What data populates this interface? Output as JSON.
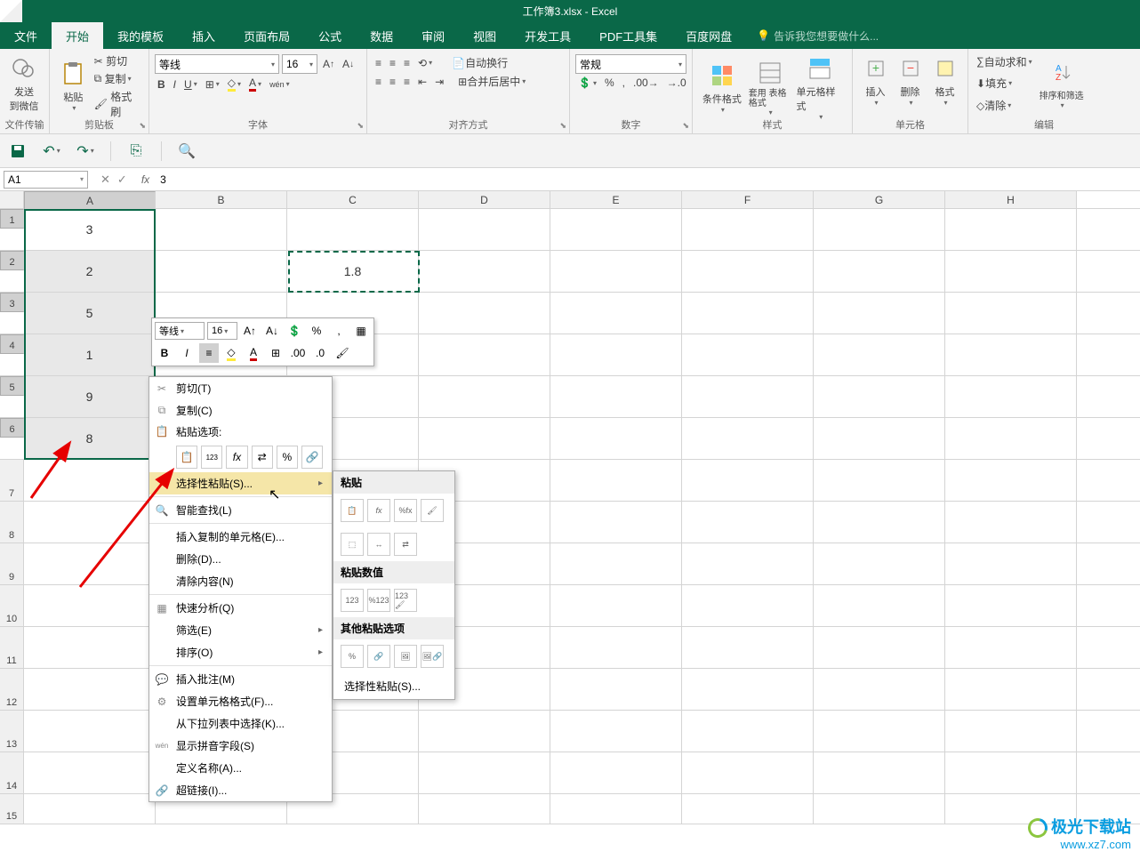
{
  "titlebar": {
    "title": "工作簿3.xlsx - Excel"
  },
  "menu": {
    "items": [
      "文件",
      "开始",
      "我的模板",
      "插入",
      "页面布局",
      "公式",
      "数据",
      "审阅",
      "视图",
      "开发工具",
      "PDF工具集",
      "百度网盘"
    ],
    "active": 1,
    "tellme": "告诉我您想要做什么..."
  },
  "ribbon": {
    "send": {
      "l1": "发送",
      "l2": "到微信",
      "group": "文件传输"
    },
    "clipboard": {
      "paste": "粘贴",
      "cut": "剪切",
      "copy": "复制",
      "format": "格式刷",
      "group": "剪贴板"
    },
    "font": {
      "name": "等线",
      "size": "16",
      "group": "字体"
    },
    "align": {
      "wrap": "自动换行",
      "merge": "合并后居中",
      "group": "对齐方式"
    },
    "number": {
      "format": "常规",
      "group": "数字"
    },
    "styles": {
      "cond": "条件格式",
      "table": "套用\n表格格式",
      "cell": "单元格样式",
      "group": "样式"
    },
    "cells": {
      "insert": "插入",
      "delete": "删除",
      "format": "格式",
      "group": "单元格"
    },
    "editing": {
      "sum": "自动求和",
      "fill": "填充",
      "clear": "清除",
      "sort": "排序和筛选",
      "group": "编辑"
    }
  },
  "namebox": "A1",
  "formula": "3",
  "columns": [
    "A",
    "B",
    "C",
    "D",
    "E",
    "F",
    "G",
    "H"
  ],
  "rows": [
    "1",
    "2",
    "3",
    "4",
    "5",
    "6",
    "7",
    "8",
    "9",
    "10",
    "11",
    "12",
    "13",
    "14",
    "15"
  ],
  "data": {
    "A1": "3",
    "A2": "2",
    "A3": "5",
    "A4": "1",
    "A5": "9",
    "A6": "8",
    "C2": "1.8"
  },
  "minibar": {
    "font": "等线",
    "size": "16"
  },
  "ctx": {
    "cut": "剪切(T)",
    "copy": "复制(C)",
    "pasteopts": "粘贴选项:",
    "pastespecial": "选择性粘贴(S)...",
    "smartlookup": "智能查找(L)",
    "insertcopied": "插入复制的单元格(E)...",
    "delete": "删除(D)...",
    "clear": "清除内容(N)",
    "quickanalysis": "快速分析(Q)",
    "filter": "筛选(E)",
    "sort": "排序(O)",
    "insertcomment": "插入批注(M)",
    "formatcells": "设置单元格格式(F)...",
    "dropdownlist": "从下拉列表中选择(K)...",
    "showpinyin": "显示拼音字段(S)",
    "definename": "定义名称(A)...",
    "hyperlink": "超链接(I)..."
  },
  "submenu": {
    "paste": "粘贴",
    "pastevalues": "粘贴数值",
    "otherpaste": "其他粘贴选项",
    "pastespecial": "选择性粘贴(S)..."
  },
  "watermark": {
    "l1": "极光下载站",
    "l2": "www.xz7.com"
  }
}
